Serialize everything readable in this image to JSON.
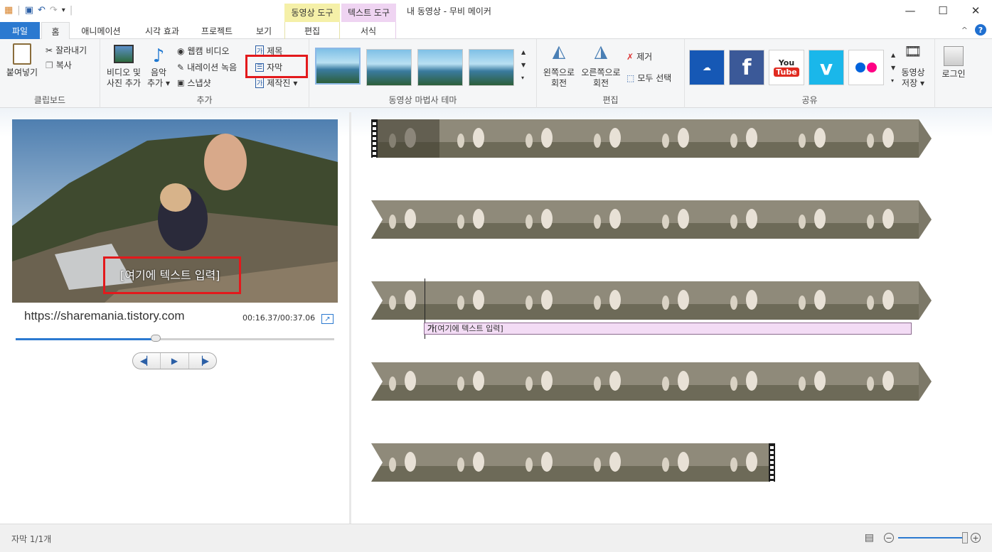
{
  "window": {
    "title": "내 동영상 - 무비 메이커",
    "context_tabs": {
      "video_tools": "동영상 도구",
      "text_tools": "텍스트 도구"
    }
  },
  "tabs": {
    "file": "파일",
    "home": "홈",
    "animation": "애니메이션",
    "visual_effects": "시각 효과",
    "project": "프로젝트",
    "view": "보기",
    "edit": "편집",
    "format": "서식"
  },
  "ribbon": {
    "clipboard": {
      "paste": "붙여넣기",
      "cut": "잘라내기",
      "copy": "복사",
      "label": "클립보드"
    },
    "add": {
      "add_video_photo_line1": "비디오 및",
      "add_video_photo_line2": "사진 추가",
      "add_music_line1": "음악",
      "add_music_line2": "추가",
      "webcam": "웹캠 비디오",
      "narration": "내레이션 녹음",
      "snapshot": "스냅샷",
      "title": "제목",
      "caption": "자막",
      "credits": "제작진",
      "label": "추가"
    },
    "themes": {
      "label": "동영상 마법사 테마"
    },
    "editing": {
      "rotate_left_line1": "왼쪽으로",
      "rotate_left_line2": "회전",
      "rotate_right_line1": "오른쪽으로",
      "rotate_right_line2": "회전",
      "remove": "제거",
      "select_all": "모두 선택",
      "label": "편집"
    },
    "share": {
      "save_movie_line1": "동영상",
      "save_movie_line2": "저장",
      "sign_in": "로그인",
      "label": "공유",
      "services": [
        {
          "name": "onedrive-icon",
          "color": "#1658b5"
        },
        {
          "name": "facebook-icon",
          "color": "#3b5998"
        },
        {
          "name": "youtube-icon",
          "color": "#e02b20"
        },
        {
          "name": "vimeo-icon",
          "color": "#1ab7ea"
        },
        {
          "name": "flickr-icon",
          "color": "#ffffff"
        }
      ]
    }
  },
  "preview": {
    "caption_text": "[여기에 텍스트 입력]",
    "url": "https://sharemania.tistory.com",
    "time": "00:16.37/00:37.06",
    "progress": 0.44
  },
  "timeline": {
    "caption_track_text": "[여기에 텍스트 입력]",
    "caption_badge": "가"
  },
  "status": {
    "caption_count": "자막 1/1개"
  }
}
